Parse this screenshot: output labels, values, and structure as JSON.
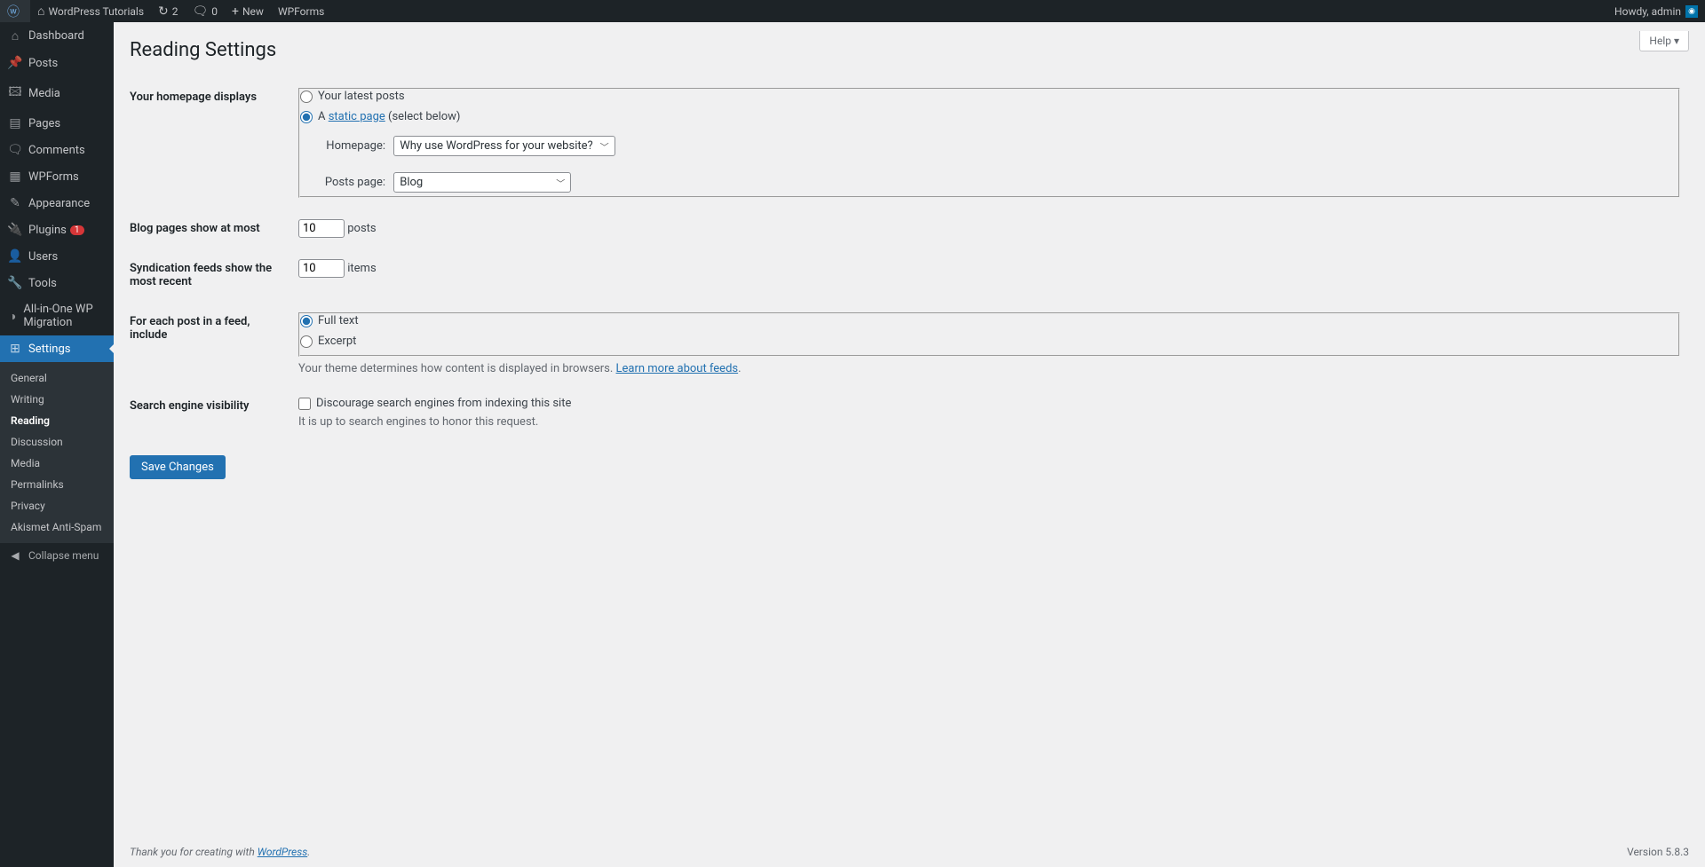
{
  "adminbar": {
    "site_name": "WordPress Tutorials",
    "updates_count": "2",
    "comments_count": "0",
    "new_label": "New",
    "wpforms_label": "WPForms",
    "howdy": "Howdy, admin"
  },
  "sidebar": {
    "items": [
      {
        "icon": "⌂",
        "label": "Dashboard"
      },
      {
        "icon": "📌",
        "label": "Posts"
      },
      {
        "icon": "🖾",
        "label": "Media"
      },
      {
        "icon": "▤",
        "label": "Pages"
      },
      {
        "icon": "🗨",
        "label": "Comments"
      },
      {
        "icon": "▦",
        "label": "WPForms"
      },
      {
        "icon": "✎",
        "label": "Appearance"
      },
      {
        "icon": "🔌",
        "label": "Plugins",
        "badge": "1"
      },
      {
        "icon": "👤",
        "label": "Users"
      },
      {
        "icon": "🔧",
        "label": "Tools"
      },
      {
        "icon": "◑",
        "label": "All-in-One WP Migration"
      },
      {
        "icon": "⊞",
        "label": "Settings",
        "current": true
      }
    ],
    "submenu": [
      {
        "label": "General"
      },
      {
        "label": "Writing"
      },
      {
        "label": "Reading",
        "current": true
      },
      {
        "label": "Discussion"
      },
      {
        "label": "Media"
      },
      {
        "label": "Permalinks"
      },
      {
        "label": "Privacy"
      },
      {
        "label": "Akismet Anti-Spam"
      }
    ],
    "collapse_label": "Collapse menu"
  },
  "page": {
    "help_label": "Help ▾",
    "title": "Reading Settings",
    "homepage_row_label": "Your homepage displays",
    "radio_latest": "Your latest posts",
    "radio_static_prefix": "A ",
    "radio_static_link": "static page",
    "radio_static_suffix": " (select below)",
    "homepage_label": "Homepage:",
    "homepage_value": "Why use WordPress for your website?",
    "postspage_label": "Posts page:",
    "postspage_value": "Blog",
    "blog_pages_row_label": "Blog pages show at most",
    "blog_pages_value": "10",
    "blog_pages_suffix": "posts",
    "feed_row_label": "Syndication feeds show the most recent",
    "feed_value": "10",
    "feed_suffix": "items",
    "feed_include_row_label": "For each post in a feed, include",
    "radio_fulltext": "Full text",
    "radio_excerpt": "Excerpt",
    "feed_desc_prefix": "Your theme determines how content is displayed in browsers. ",
    "feed_desc_link": "Learn more about feeds",
    "search_row_label": "Search engine visibility",
    "search_checkbox_label": "Discourage search engines from indexing this site",
    "search_desc": "It is up to search engines to honor this request.",
    "save_label": "Save Changes"
  },
  "footer": {
    "thanks_prefix": "Thank you for creating with ",
    "thanks_link": "WordPress",
    "version": "Version 5.8.3"
  }
}
